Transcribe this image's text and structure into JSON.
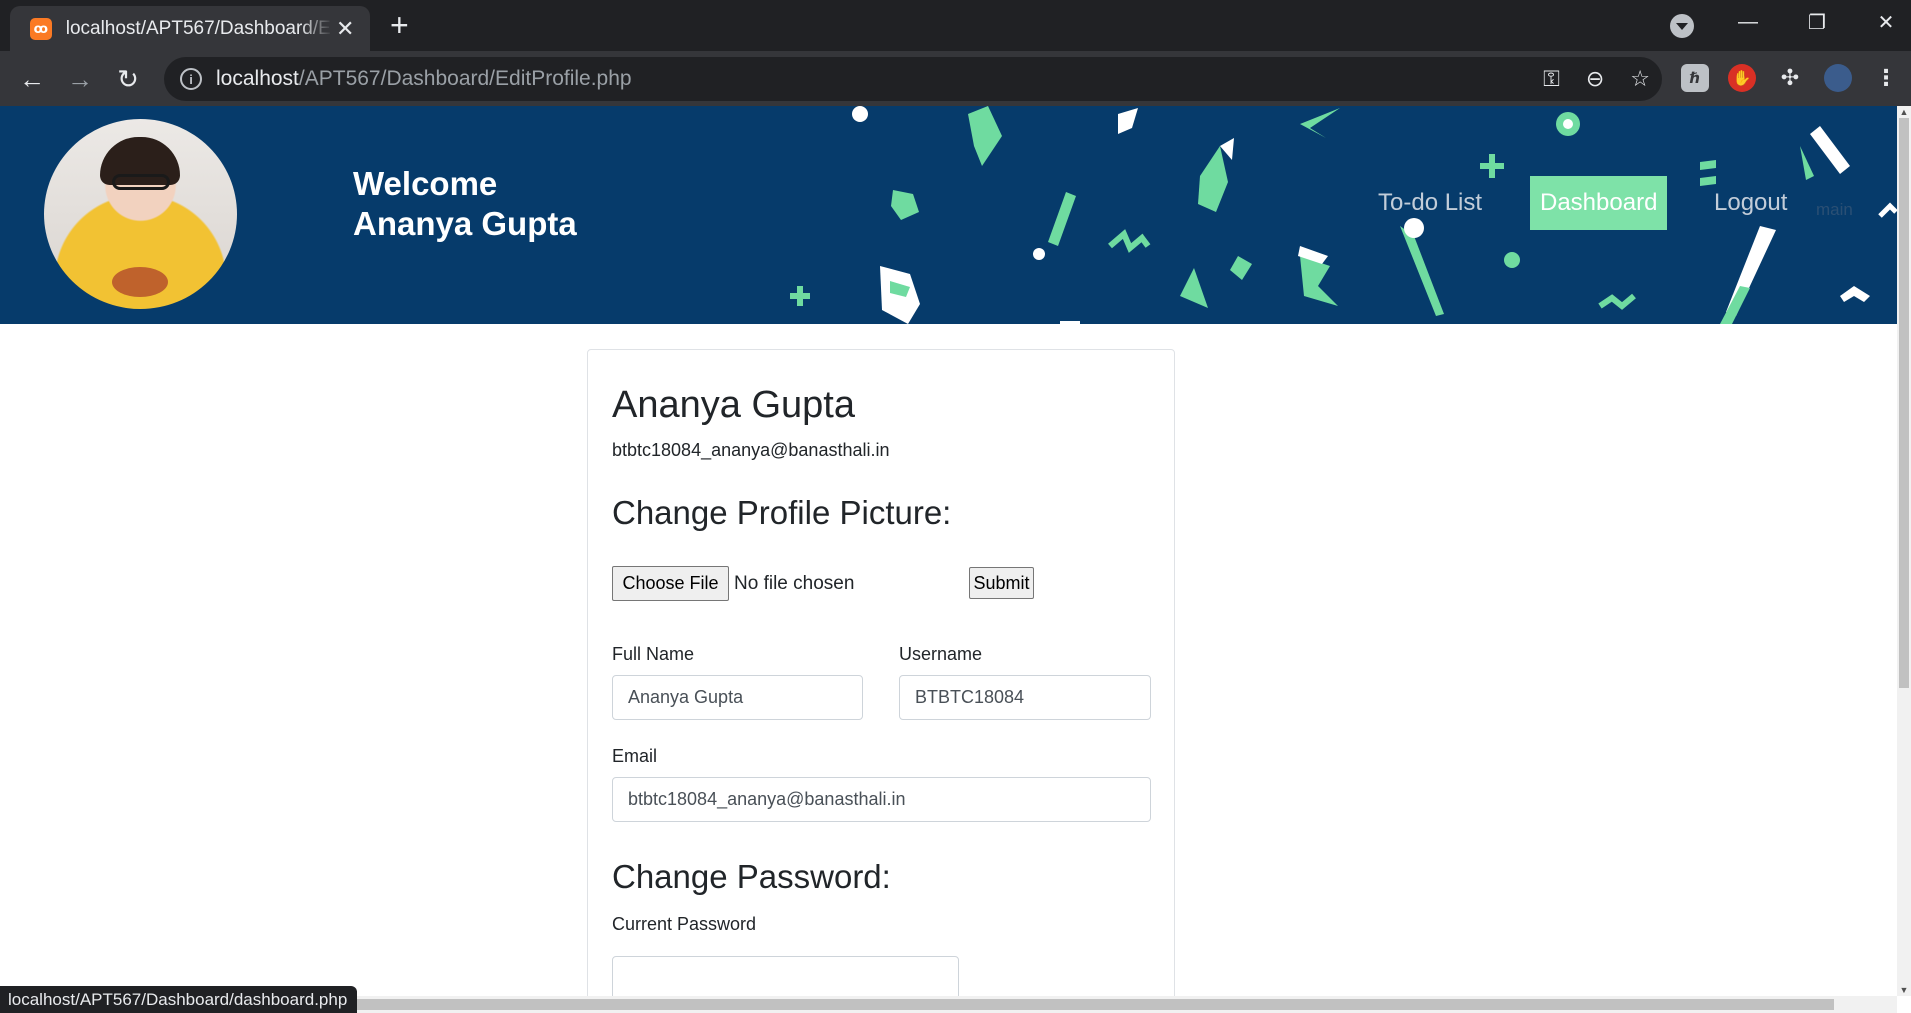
{
  "browser": {
    "tab_title": "localhost/APT567/Dashboard/EditProfile.php",
    "new_tab": "+",
    "url_host": "localhost",
    "url_path": "/APT567/Dashboard/EditProfile.php",
    "status_url": "localhost/APT567/Dashboard/dashboard.php"
  },
  "header": {
    "welcome_line1": "Welcome",
    "welcome_line2": "Ananya Gupta",
    "nav": {
      "todo": "To-do List",
      "dashboard": "Dashboard",
      "logout": "Logout",
      "main": "main"
    },
    "colors": {
      "banner": "#063b6b",
      "accent": "#7ee2a8"
    }
  },
  "profile": {
    "name": "Ananya Gupta",
    "email": "btbtc18084_ananya@banasthali.in",
    "picture_heading": "Change Profile Picture:",
    "choose_file": "Choose File",
    "file_status": "No file chosen",
    "submit": "Submit",
    "full_name_label": "Full Name",
    "full_name_value": "Ananya Gupta",
    "username_label": "Username",
    "username_value": "BTBTC18084",
    "email_label": "Email",
    "email_value": "btbtc18084_ananya@banasthali.in",
    "password_heading": "Change Password:",
    "current_password_label": "Current Password",
    "current_password_value": ""
  }
}
